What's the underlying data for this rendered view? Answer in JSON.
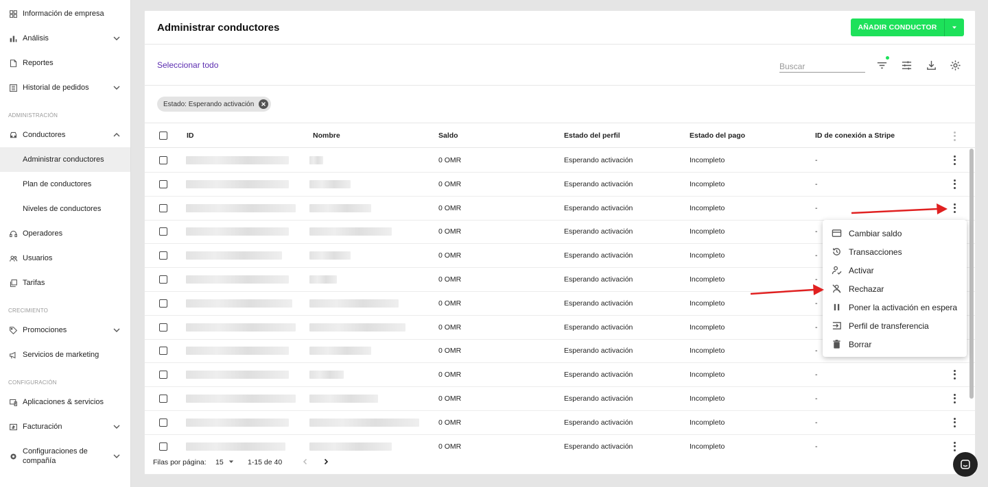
{
  "sidebar": {
    "items": [
      {
        "label": "Información de empresa",
        "icon": "grid-icon"
      },
      {
        "label": "Análisis",
        "icon": "bar-chart-icon"
      },
      {
        "label": "Reportes",
        "icon": "document-icon"
      },
      {
        "label": "Historial de pedidos",
        "icon": "list-icon"
      }
    ],
    "sections": {
      "admin": "ADMINISTRACIÓN",
      "growth": "CRECIMIENTO",
      "config": "CONFIGURACIÓN"
    },
    "admin_items": {
      "drivers": "Conductores",
      "manage_drivers": "Administrar conductores",
      "driver_plans": "Plan de conductores",
      "driver_levels": "Niveles de conductores",
      "operators": "Operadores",
      "users": "Usuarios",
      "rates": "Tarifas"
    },
    "growth_items": {
      "promotions": "Promociones",
      "marketing": "Servicios de marketing"
    },
    "config_items": {
      "apps": "Aplicaciones & servicios",
      "billing": "Facturación",
      "company_config_line1": "Configuraciones de",
      "company_config_line2": "compañía"
    }
  },
  "header": {
    "title": "Administrar conductores",
    "add_button": "AÑADIR CONDUCTOR"
  },
  "toolbar": {
    "select_all": "Seleccionar todo",
    "search_placeholder": "Buscar"
  },
  "filter_chip": "Estado: Esperando activación",
  "table": {
    "columns": [
      "ID",
      "Nombre",
      "Saldo",
      "Estado del perfil",
      "Estado del pago",
      "ID de conexión a Stripe"
    ],
    "rows": [
      {
        "balance": "0 OMR",
        "profile": "Esperando activación",
        "payment": "Incompleto",
        "stripe": "-"
      },
      {
        "balance": "0 OMR",
        "profile": "Esperando activación",
        "payment": "Incompleto",
        "stripe": "-"
      },
      {
        "balance": "0 OMR",
        "profile": "Esperando activación",
        "payment": "Incompleto",
        "stripe": "-"
      },
      {
        "balance": "0 OMR",
        "profile": "Esperando activación",
        "payment": "Incompleto",
        "stripe": "-"
      },
      {
        "balance": "0 OMR",
        "profile": "Esperando activación",
        "payment": "Incompleto",
        "stripe": "-"
      },
      {
        "balance": "0 OMR",
        "profile": "Esperando activación",
        "payment": "Incompleto",
        "stripe": "-"
      },
      {
        "balance": "0 OMR",
        "profile": "Esperando activación",
        "payment": "Incompleto",
        "stripe": "-"
      },
      {
        "balance": "0 OMR",
        "profile": "Esperando activación",
        "payment": "Incompleto",
        "stripe": "-"
      },
      {
        "balance": "0 OMR",
        "profile": "Esperando activación",
        "payment": "Incompleto",
        "stripe": "-"
      },
      {
        "balance": "0 OMR",
        "profile": "Esperando activación",
        "payment": "Incompleto",
        "stripe": "-"
      },
      {
        "balance": "0 OMR",
        "profile": "Esperando activación",
        "payment": "Incompleto",
        "stripe": "-"
      },
      {
        "balance": "0 OMR",
        "profile": "Esperando activación",
        "payment": "Incompleto",
        "stripe": "-"
      },
      {
        "balance": "0 OMR",
        "profile": "Esperando activación",
        "payment": "Incompleto",
        "stripe": "-"
      }
    ]
  },
  "footer": {
    "rows_per_page_label": "Filas por página:",
    "rows_per_page": "15",
    "range": "1-15 de 40"
  },
  "context_menu": [
    {
      "label": "Cambiar saldo",
      "icon": "credit-card-icon"
    },
    {
      "label": "Transacciones",
      "icon": "history-icon"
    },
    {
      "label": "Activar",
      "icon": "person-check-icon"
    },
    {
      "label": "Rechazar",
      "icon": "person-off-icon"
    },
    {
      "label": "Poner la activación en espera",
      "icon": "pause-icon"
    },
    {
      "label": "Perfil de transferencia",
      "icon": "transfer-icon"
    },
    {
      "label": "Borrar",
      "icon": "trash-icon"
    }
  ],
  "colors": {
    "accent_green": "#1de15a",
    "link_purple": "#5b2cb0",
    "annotation_red": "#e02020"
  }
}
